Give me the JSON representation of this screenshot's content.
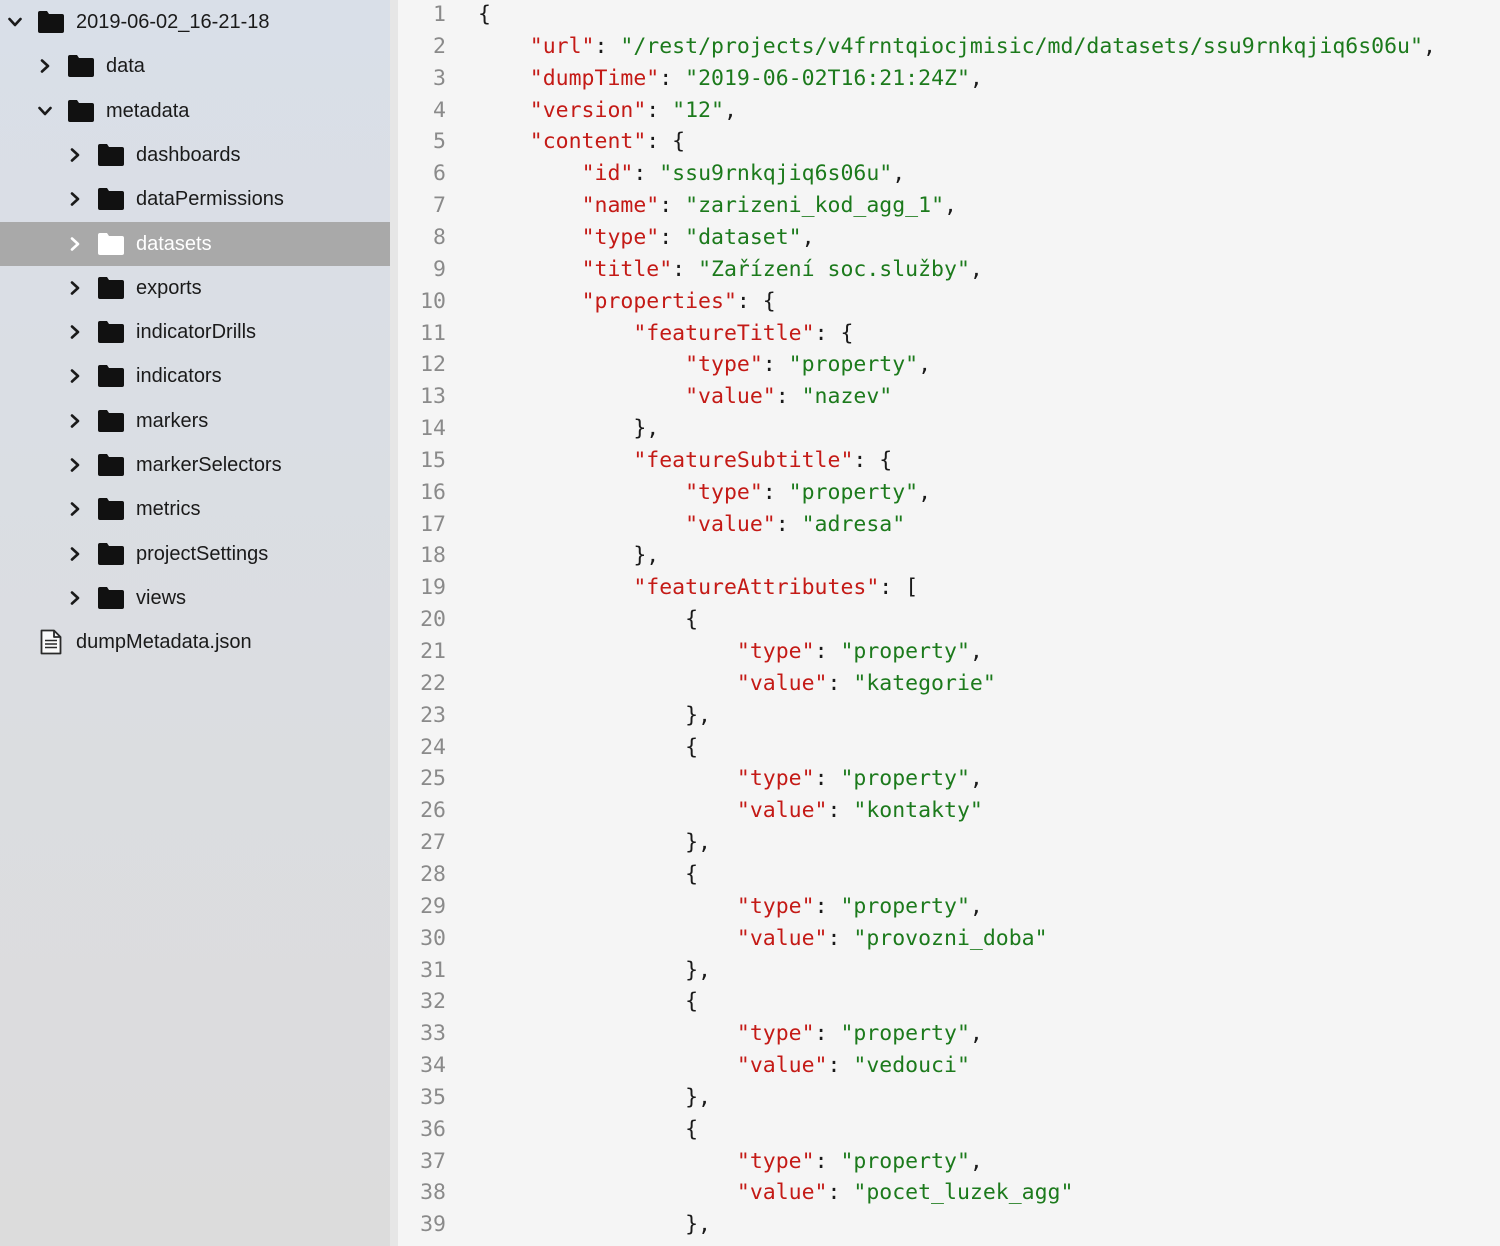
{
  "sidebar": {
    "root": {
      "label": "2019-06-02_16-21-18",
      "expanded": true
    },
    "items": [
      {
        "label": "data",
        "depth": 1,
        "kind": "folder",
        "expanded": false
      },
      {
        "label": "metadata",
        "depth": 1,
        "kind": "folder",
        "expanded": true
      },
      {
        "label": "dashboards",
        "depth": 2,
        "kind": "folder",
        "expanded": false
      },
      {
        "label": "dataPermissions",
        "depth": 2,
        "kind": "folder",
        "expanded": false
      },
      {
        "label": "datasets",
        "depth": 2,
        "kind": "folder",
        "expanded": false,
        "selected": true
      },
      {
        "label": "exports",
        "depth": 2,
        "kind": "folder",
        "expanded": false
      },
      {
        "label": "indicatorDrills",
        "depth": 2,
        "kind": "folder",
        "expanded": false
      },
      {
        "label": "indicators",
        "depth": 2,
        "kind": "folder",
        "expanded": false
      },
      {
        "label": "markers",
        "depth": 2,
        "kind": "folder",
        "expanded": false
      },
      {
        "label": "markerSelectors",
        "depth": 2,
        "kind": "folder",
        "expanded": false
      },
      {
        "label": "metrics",
        "depth": 2,
        "kind": "folder",
        "expanded": false
      },
      {
        "label": "projectSettings",
        "depth": 2,
        "kind": "folder",
        "expanded": false
      },
      {
        "label": "views",
        "depth": 2,
        "kind": "folder",
        "expanded": false
      },
      {
        "label": "dumpMetadata.json",
        "depth": 1,
        "kind": "file"
      }
    ]
  },
  "editor": {
    "colors": {
      "key": "#c41a16",
      "string": "#1c7a1c",
      "punct": "#1a1a1a",
      "gutter": "#8a8a8a"
    },
    "lines": [
      {
        "n": "1",
        "indent": 0,
        "key": "",
        "sep": "",
        "value": "",
        "tail": "{"
      },
      {
        "n": "2",
        "indent": 1,
        "key": "\"url\"",
        "sep": ": ",
        "value": "\"/rest/projects/v4frntqiocjmisic/md/datasets/ssu9rnkqjiq6s06u\"",
        "tail": ","
      },
      {
        "n": "3",
        "indent": 1,
        "key": "\"dumpTime\"",
        "sep": ": ",
        "value": "\"2019-06-02T16:21:24Z\"",
        "tail": ","
      },
      {
        "n": "4",
        "indent": 1,
        "key": "\"version\"",
        "sep": ": ",
        "value": "\"12\"",
        "tail": ","
      },
      {
        "n": "5",
        "indent": 1,
        "key": "\"content\"",
        "sep": ": ",
        "value": "",
        "tail": "{"
      },
      {
        "n": "6",
        "indent": 2,
        "key": "\"id\"",
        "sep": ": ",
        "value": "\"ssu9rnkqjiq6s06u\"",
        "tail": ","
      },
      {
        "n": "7",
        "indent": 2,
        "key": "\"name\"",
        "sep": ": ",
        "value": "\"zarizeni_kod_agg_1\"",
        "tail": ","
      },
      {
        "n": "8",
        "indent": 2,
        "key": "\"type\"",
        "sep": ": ",
        "value": "\"dataset\"",
        "tail": ","
      },
      {
        "n": "9",
        "indent": 2,
        "key": "\"title\"",
        "sep": ": ",
        "value": "\"Zařízení soc.služby\"",
        "tail": ","
      },
      {
        "n": "10",
        "indent": 2,
        "key": "\"properties\"",
        "sep": ": ",
        "value": "",
        "tail": "{"
      },
      {
        "n": "11",
        "indent": 3,
        "key": "\"featureTitle\"",
        "sep": ": ",
        "value": "",
        "tail": "{"
      },
      {
        "n": "12",
        "indent": 4,
        "key": "\"type\"",
        "sep": ": ",
        "value": "\"property\"",
        "tail": ","
      },
      {
        "n": "13",
        "indent": 4,
        "key": "\"value\"",
        "sep": ": ",
        "value": "\"nazev\"",
        "tail": ""
      },
      {
        "n": "14",
        "indent": 3,
        "key": "",
        "sep": "",
        "value": "",
        "tail": "},"
      },
      {
        "n": "15",
        "indent": 3,
        "key": "\"featureSubtitle\"",
        "sep": ": ",
        "value": "",
        "tail": "{"
      },
      {
        "n": "16",
        "indent": 4,
        "key": "\"type\"",
        "sep": ": ",
        "value": "\"property\"",
        "tail": ","
      },
      {
        "n": "17",
        "indent": 4,
        "key": "\"value\"",
        "sep": ": ",
        "value": "\"adresa\"",
        "tail": ""
      },
      {
        "n": "18",
        "indent": 3,
        "key": "",
        "sep": "",
        "value": "",
        "tail": "},"
      },
      {
        "n": "19",
        "indent": 3,
        "key": "\"featureAttributes\"",
        "sep": ": ",
        "value": "",
        "tail": "["
      },
      {
        "n": "20",
        "indent": 4,
        "key": "",
        "sep": "",
        "value": "",
        "tail": "{"
      },
      {
        "n": "21",
        "indent": 5,
        "key": "\"type\"",
        "sep": ": ",
        "value": "\"property\"",
        "tail": ","
      },
      {
        "n": "22",
        "indent": 5,
        "key": "\"value\"",
        "sep": ": ",
        "value": "\"kategorie\"",
        "tail": ""
      },
      {
        "n": "23",
        "indent": 4,
        "key": "",
        "sep": "",
        "value": "",
        "tail": "},"
      },
      {
        "n": "24",
        "indent": 4,
        "key": "",
        "sep": "",
        "value": "",
        "tail": "{"
      },
      {
        "n": "25",
        "indent": 5,
        "key": "\"type\"",
        "sep": ": ",
        "value": "\"property\"",
        "tail": ","
      },
      {
        "n": "26",
        "indent": 5,
        "key": "\"value\"",
        "sep": ": ",
        "value": "\"kontakty\"",
        "tail": ""
      },
      {
        "n": "27",
        "indent": 4,
        "key": "",
        "sep": "",
        "value": "",
        "tail": "},"
      },
      {
        "n": "28",
        "indent": 4,
        "key": "",
        "sep": "",
        "value": "",
        "tail": "{"
      },
      {
        "n": "29",
        "indent": 5,
        "key": "\"type\"",
        "sep": ": ",
        "value": "\"property\"",
        "tail": ","
      },
      {
        "n": "30",
        "indent": 5,
        "key": "\"value\"",
        "sep": ": ",
        "value": "\"provozni_doba\"",
        "tail": ""
      },
      {
        "n": "31",
        "indent": 4,
        "key": "",
        "sep": "",
        "value": "",
        "tail": "},"
      },
      {
        "n": "32",
        "indent": 4,
        "key": "",
        "sep": "",
        "value": "",
        "tail": "{"
      },
      {
        "n": "33",
        "indent": 5,
        "key": "\"type\"",
        "sep": ": ",
        "value": "\"property\"",
        "tail": ","
      },
      {
        "n": "34",
        "indent": 5,
        "key": "\"value\"",
        "sep": ": ",
        "value": "\"vedouci\"",
        "tail": ""
      },
      {
        "n": "35",
        "indent": 4,
        "key": "",
        "sep": "",
        "value": "",
        "tail": "},"
      },
      {
        "n": "36",
        "indent": 4,
        "key": "",
        "sep": "",
        "value": "",
        "tail": "{"
      },
      {
        "n": "37",
        "indent": 5,
        "key": "\"type\"",
        "sep": ": ",
        "value": "\"property\"",
        "tail": ","
      },
      {
        "n": "38",
        "indent": 5,
        "key": "\"value\"",
        "sep": ": ",
        "value": "\"pocet_luzek_agg\"",
        "tail": ""
      },
      {
        "n": "39",
        "indent": 4,
        "key": "",
        "sep": "",
        "value": "",
        "tail": "},"
      }
    ]
  }
}
